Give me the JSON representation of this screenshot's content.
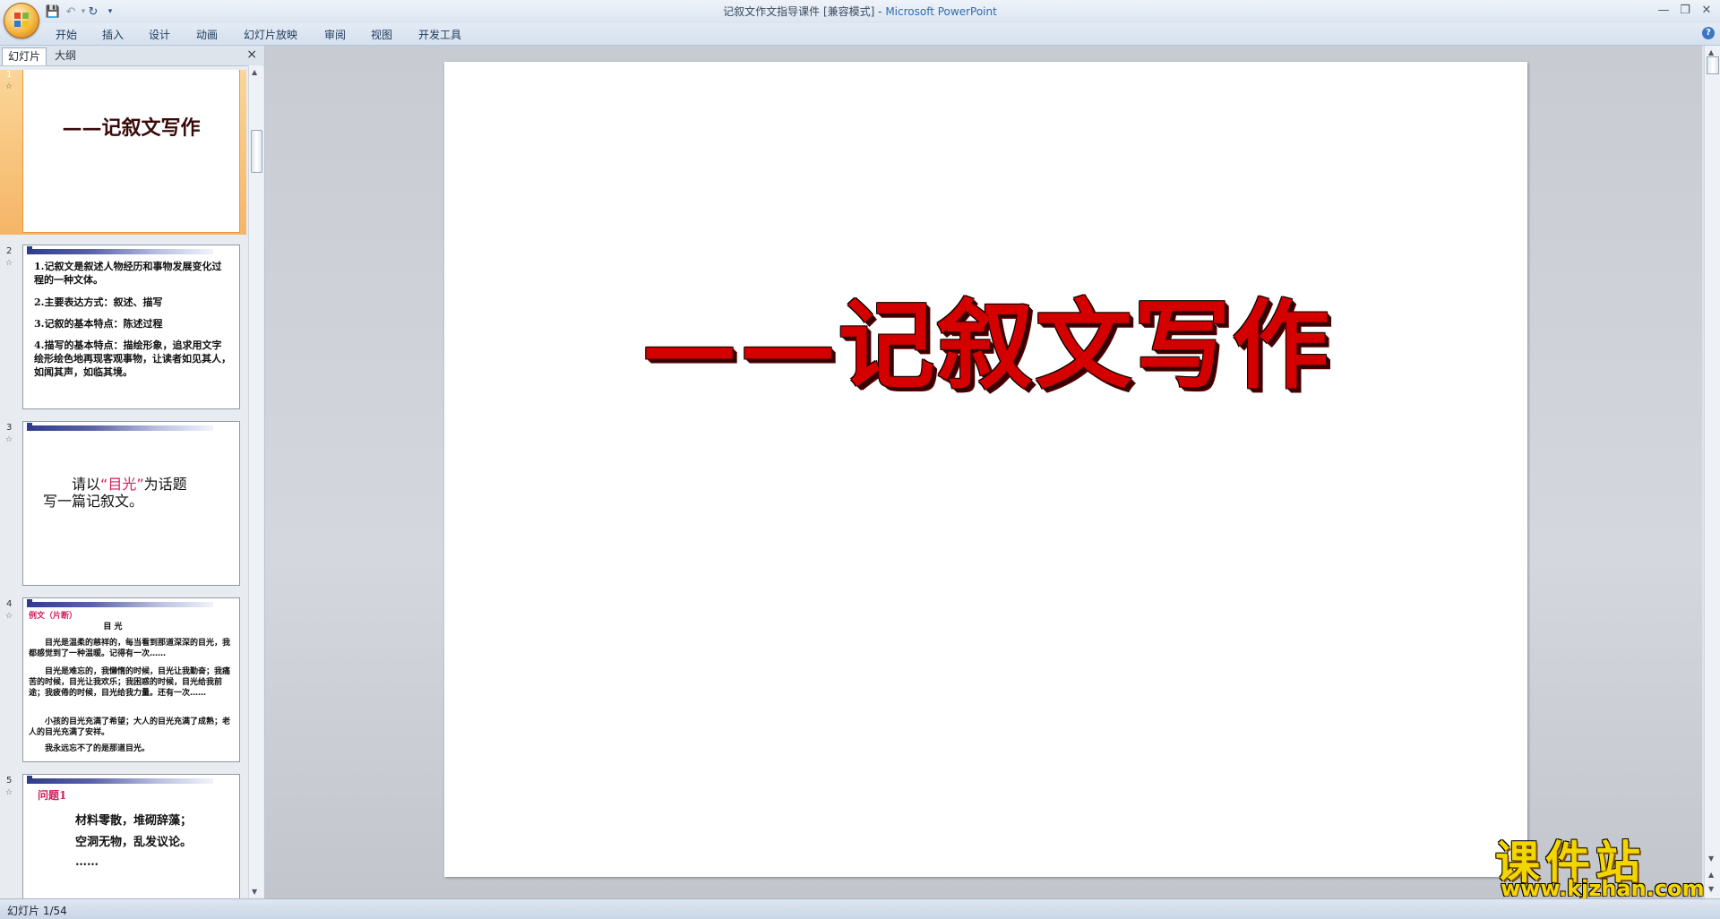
{
  "window": {
    "title_doc": "记叙文作文指导课件 [兼容模式] -",
    "title_app": " Microsoft PowerPoint"
  },
  "ribbon": {
    "tabs": [
      "开始",
      "插入",
      "设计",
      "动画",
      "幻灯片放映",
      "审阅",
      "视图",
      "开发工具"
    ]
  },
  "left_pane": {
    "tab_slides": "幻灯片",
    "tab_outline": "大纲",
    "close_glyph": "×"
  },
  "thumbnails": [
    {
      "num": "1",
      "title": "——记叙文写作"
    },
    {
      "num": "2",
      "lines": [
        "1.记叙文是叙述人物经历和事物发展变化过程的一种文体。",
        "2.主要表达方式：叙述、描写",
        "3.记叙的基本特点：陈述过程",
        "4.描写的基本特点：描绘形象，追求用文字绘形绘色地再现客观事物，让读者如见其人，如闻其声，如临其境。"
      ]
    },
    {
      "num": "3",
      "pre": "请以",
      "highlight": "“目光”",
      "post": "为话题",
      "line2": "写一篇记叙文。"
    },
    {
      "num": "4",
      "label": "例文（片断）",
      "heading": "目 光",
      "paragraphs": [
        "　　目光是温柔的慈祥的，每当看到那道深深的目光，我都感觉到了一种温暖。记得有一次……",
        "　　目光是难忘的，我懒惰的时候，目光让我勤奋；我痛苦的时候，目光让我欢乐；我困惑的时候，目光给我前途；我疲倦的时候，目光给我力量。还有一次……",
        "　　小孩的目光充满了希望；大人的目光充满了成熟；老人的目光充满了安祥。",
        "　　我永远忘不了的是那道目光。"
      ]
    },
    {
      "num": "5",
      "label": "问题1",
      "lines": [
        "材料零散，堆砌辞藻；",
        "空洞无物，乱发议论。",
        "……"
      ]
    }
  ],
  "slide": {
    "title": "——记叙文写作"
  },
  "status": {
    "slide_indicator": "幻灯片 1/54"
  },
  "watermark": {
    "cn": "课件站",
    "url": "www.kjzhan.com"
  },
  "colors": {
    "title_red": "#d40000",
    "selection_orange": "#f5b567",
    "highlight_pink": "#d21f5a",
    "watermark_yellow": "#f2d600"
  }
}
